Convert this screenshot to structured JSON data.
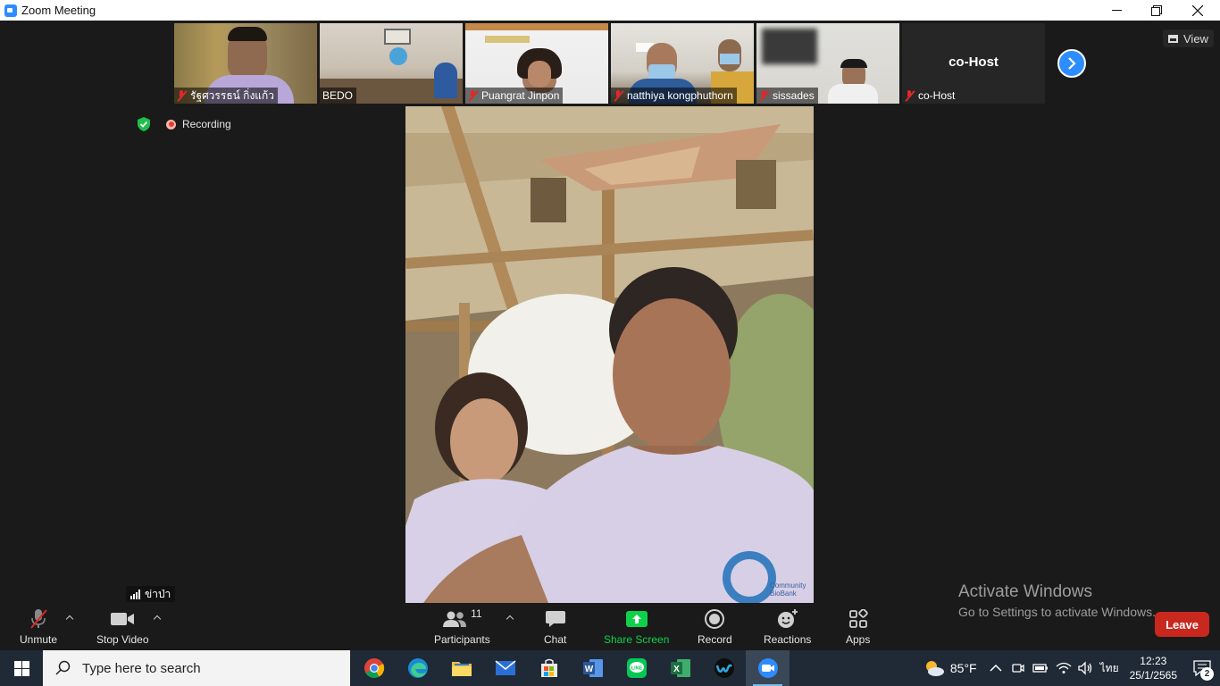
{
  "window": {
    "title": "Zoom Meeting",
    "minimize_icon": "minimize-icon",
    "restore_icon": "restore-icon",
    "close_icon": "close-icon"
  },
  "thumbnails": [
    {
      "name": "รัฐศวรรธน์ กิ่งแก้ว",
      "muted": true
    },
    {
      "name": "BEDO",
      "muted": false
    },
    {
      "name": "Puangrat Jinpon",
      "muted": true
    },
    {
      "name": "natthiya kongphuthorn",
      "muted": true
    },
    {
      "name": "sissades",
      "muted": true
    },
    {
      "name": "co-Host",
      "muted": true,
      "tile_text": "co-Host"
    }
  ],
  "view_button": "View",
  "recording": "Recording",
  "active_speaker": {
    "label": "ข่าป่า",
    "shirt_text": "Community BioBank"
  },
  "activate_windows": {
    "line1": "Activate Windows",
    "line2": "Go to Settings to activate Windows."
  },
  "toolbar": {
    "unmute": "Unmute",
    "stop_video": "Stop Video",
    "participants": "Participants",
    "participants_count": "11",
    "chat": "Chat",
    "share_screen": "Share Screen",
    "record": "Record",
    "reactions": "Reactions",
    "apps": "Apps",
    "leave": "Leave"
  },
  "taskbar": {
    "search_placeholder": "Type here to search",
    "temperature": "85°F",
    "language": "ไทย",
    "time": "12:23",
    "date": "25/1/2565",
    "notification_count": "2"
  },
  "colors": {
    "zoom_blue": "#2d8cff",
    "share_green": "#0fd14b",
    "leave_red": "#c8281e",
    "muted_red": "#e02828"
  }
}
